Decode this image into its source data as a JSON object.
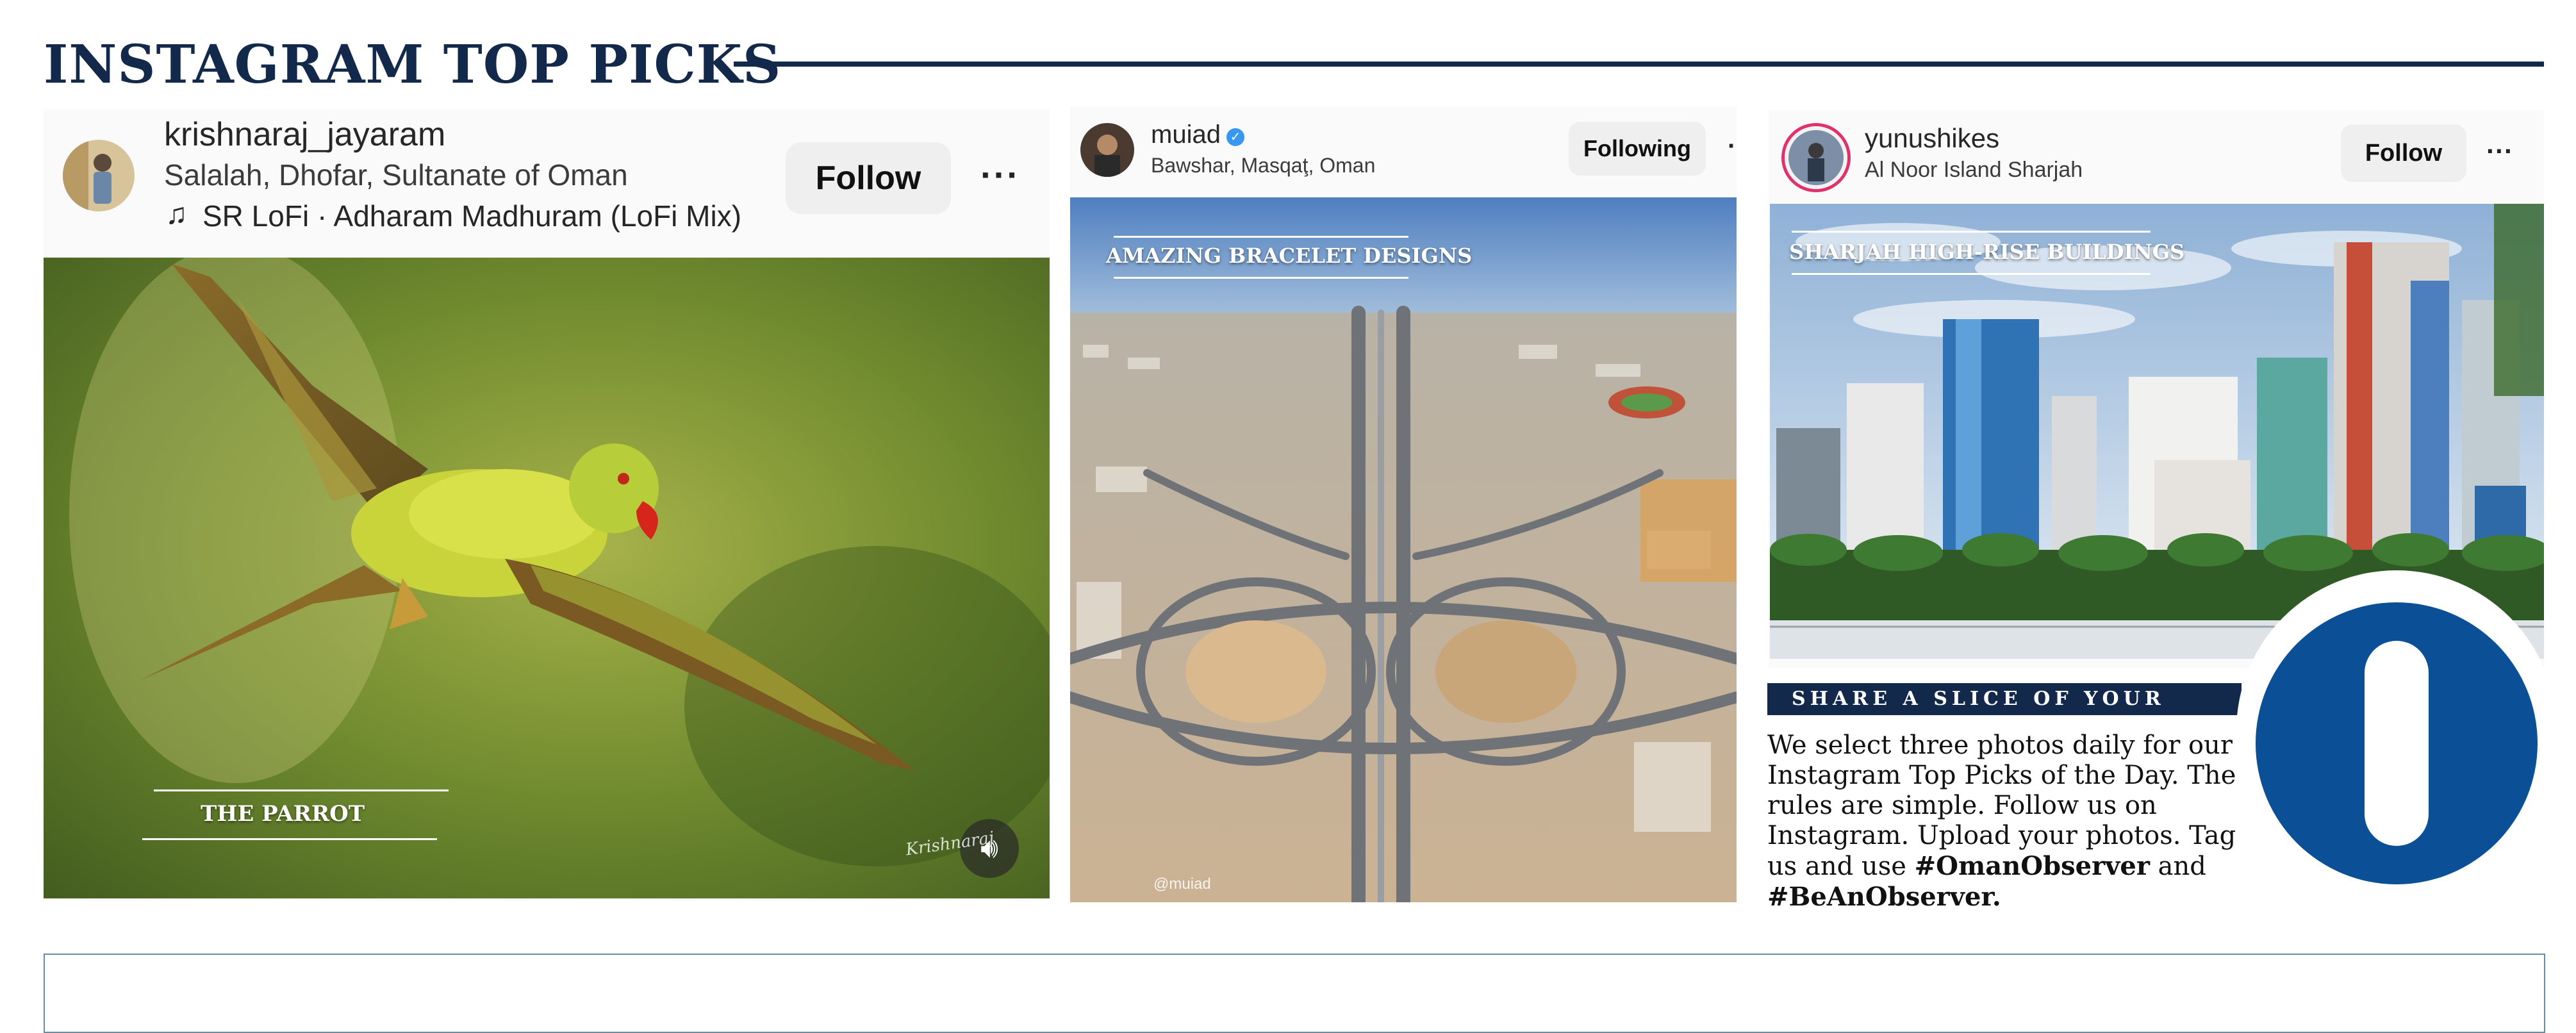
{
  "header": {
    "title": "INSTAGRAM TOP PICKS"
  },
  "posts": [
    {
      "username": "krishnaraj_jayaram",
      "location": "Salalah, Dhofar, Sultanate of Oman",
      "music": "SR LoFi · Adharam Madhuram (LoFi Mix)",
      "follow_label": "Follow",
      "caption": "THE PARROT",
      "watermark": "Krishnaraj"
    },
    {
      "username": "muiad",
      "location": "Bawshar, Masqaţ, Oman",
      "follow_label": "Following",
      "caption": "AMAZING BRACELET DESIGNS",
      "watermark": "@muiad"
    },
    {
      "username": "yunushikes",
      "location": "Al Noor Island Sharjah",
      "follow_label": "Follow",
      "caption": "SHARJAH HIGH-RISE BUILDINGS"
    }
  ],
  "share": {
    "heading": "SHARE A SLICE OF YOUR LIFE",
    "text": "We select three photos daily for our Instagram Top Picks of the Day. The rules are simple. Follow us on Instagram. Upload your photos. Tag us and use",
    "hashtag1": "#OmanObserver",
    "and": "and",
    "hashtag2": "#BeAnObserver."
  },
  "logo": {
    "letter": "O"
  },
  "icons": {
    "music": "music-note-icon",
    "more": "more-icon",
    "verified": "verified-badge-icon",
    "sound": "speaker-icon"
  },
  "colors": {
    "navy": "#13294b",
    "logo_blue": "#0b4f96"
  }
}
